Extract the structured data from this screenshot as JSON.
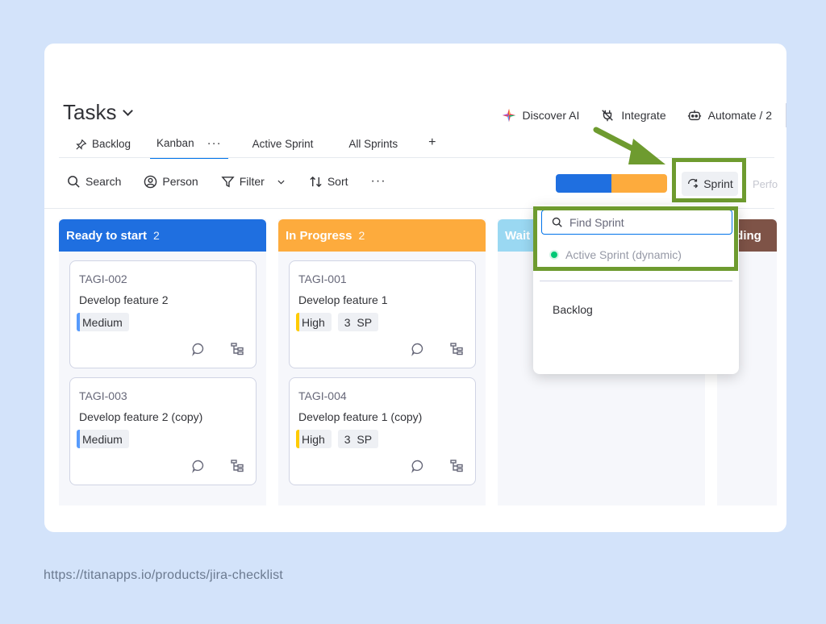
{
  "board": {
    "title": "Tasks"
  },
  "top_actions": [
    {
      "label": "Discover AI",
      "icon": "sparkle-icon"
    },
    {
      "label": "Integrate",
      "icon": "plug-icon"
    },
    {
      "label": "Automate / 2",
      "icon": "robot-icon"
    }
  ],
  "tabs": [
    {
      "label": "Backlog",
      "icon": "pin-icon"
    },
    {
      "label": "Kanban",
      "active": true,
      "more": "···"
    },
    {
      "label": "Active Sprint"
    },
    {
      "label": "All Sprints"
    },
    {
      "label": "+"
    }
  ],
  "toolbar": {
    "search": "Search",
    "person": "Person",
    "filter": "Filter",
    "sort": "Sort",
    "more": "···",
    "sprint": "Sprint",
    "perf": "Perfo"
  },
  "sprint_progress": {
    "done_fraction": 0.5,
    "colors": [
      "#1f6fe0",
      "#fdab3d"
    ]
  },
  "columns": [
    {
      "title": "Ready to start",
      "count": "2",
      "color": "#1f6fe0",
      "cards": [
        {
          "id": "TAGI-002",
          "name": "Develop feature 2",
          "priority": "Medium"
        },
        {
          "id": "TAGI-003",
          "name": "Develop feature 2 (copy)",
          "priority": "Medium"
        }
      ]
    },
    {
      "title": "In Progress",
      "count": "2",
      "color": "#fdab3d",
      "cards": [
        {
          "id": "TAGI-001",
          "name": "Develop feature 1",
          "priority": "High",
          "points": "3  SP"
        },
        {
          "id": "TAGI-004",
          "name": "Develop feature 1 (copy)",
          "priority": "High",
          "points": "3  SP"
        }
      ]
    },
    {
      "title": "Wait",
      "color": "#9ad8f2"
    },
    {
      "title": "nding",
      "color": "#7e5347"
    }
  ],
  "sprint_dropdown": {
    "search_placeholder": "Find Sprint",
    "active_option": "Active Sprint (dynamic)",
    "options": [
      "Backlog"
    ]
  },
  "caption": "https://titanapps.io/products/jira-checklist",
  "colors": {
    "highlight": "#6e9b2f",
    "accent": "#0073ea"
  }
}
